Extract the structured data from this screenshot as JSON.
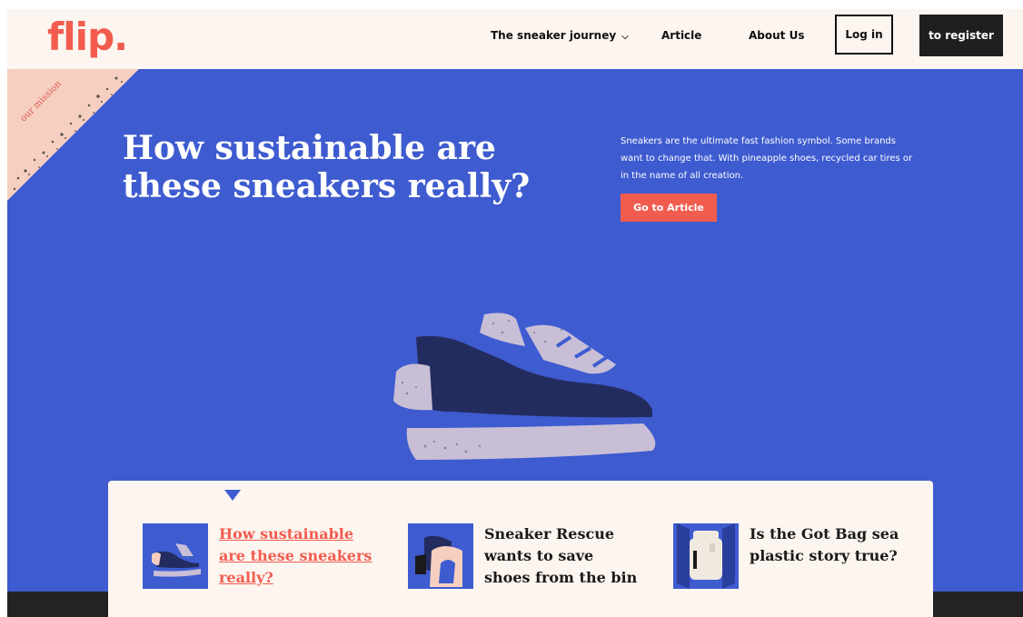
{
  "header": {
    "logo": "flip.",
    "nav": {
      "journey": "The sneaker journey",
      "article": "Article",
      "about": "About Us"
    },
    "login_label": "Log in",
    "register_label": "to register"
  },
  "hero": {
    "corner_text": "our mission",
    "title": "How sustainable are these sneakers really?",
    "description": "Sneakers are the ultimate fast fashion symbol. Some brands want to change that. With pineapple shoes, recycled car tires or in the name of all creation.",
    "cta_label": "Go to Article"
  },
  "stories": [
    {
      "title": "How sustainable are these sneakers really?",
      "thumb_icon": "sneaker-thumb-icon"
    },
    {
      "title": "Sneaker Rescue wants to save shoes from the bin",
      "thumb_icon": "sneaker-rescue-thumb-icon"
    },
    {
      "title": "Is the Got Bag sea plastic story true?",
      "thumb_icon": "backpack-thumb-icon"
    }
  ],
  "colors": {
    "brand": "#f25c4f",
    "hero_bg": "#3e5bd0",
    "header_bg": "#fdf5ef",
    "dark": "#1f1f1f"
  }
}
